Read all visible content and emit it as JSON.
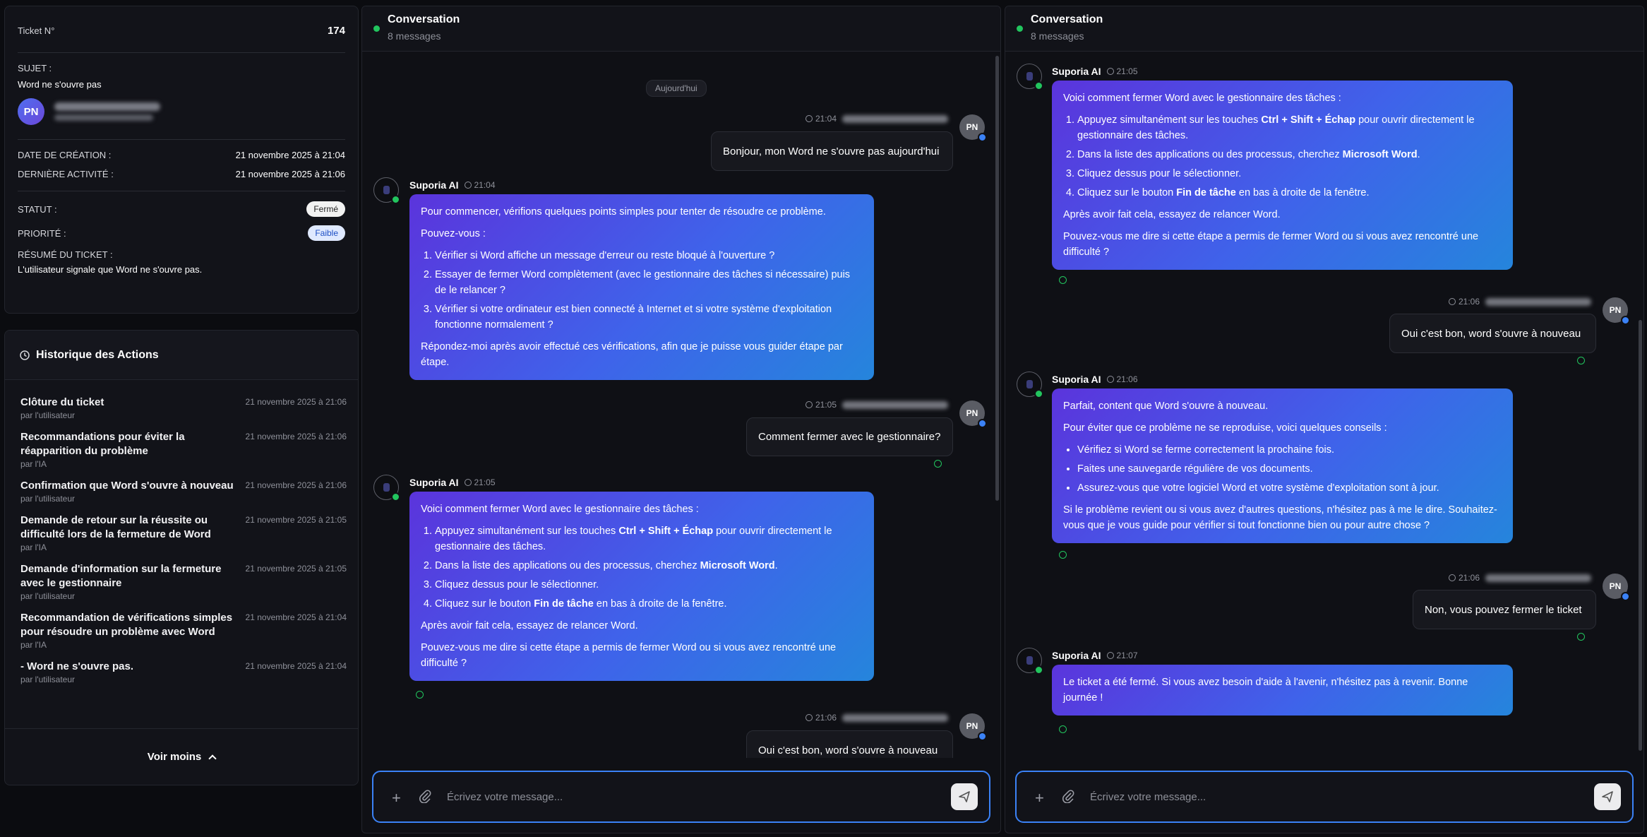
{
  "ticket": {
    "number_label": "Ticket N°",
    "number": "174",
    "subject_label": "SUJET :",
    "subject": "Word ne s'ouvre pas",
    "user_initials": "PN",
    "created_label": "DATE DE CRÉATION :",
    "created": "21 novembre 2025 à 21:04",
    "last_activity_label": "DERNIÈRE ACTIVITÉ :",
    "last_activity": "21 novembre 2025 à 21:06",
    "status_label": "STATUT :",
    "status": "Fermé",
    "priority_label": "PRIORITÉ :",
    "priority": "Faible",
    "summary_label": "RÉSUMÉ DU TICKET :",
    "summary": "L'utilisateur signale que Word ne s'ouvre pas."
  },
  "history": {
    "title": "Historique des Actions",
    "items": [
      {
        "title": "Clôture du ticket",
        "by": "par l'utilisateur",
        "date": "21 novembre 2025 à 21:06"
      },
      {
        "title": "Recommandations pour éviter la réapparition du problème",
        "by": "par l'IA",
        "date": "21 novembre 2025 à 21:06"
      },
      {
        "title": "Confirmation que Word s'ouvre à nouveau",
        "by": "par l'utilisateur",
        "date": "21 novembre 2025 à 21:06"
      },
      {
        "title": "Demande de retour sur la réussite ou difficulté lors de la fermeture de Word",
        "by": "par l'IA",
        "date": "21 novembre 2025 à 21:05"
      },
      {
        "title": "Demande d'information sur la fermeture avec le gestionnaire",
        "by": "par l'utilisateur",
        "date": "21 novembre 2025 à 21:05"
      },
      {
        "title": "Recommandation de vérifications simples pour résoudre un problème avec Word",
        "by": "par l'IA",
        "date": "21 novembre 2025 à 21:04"
      },
      {
        "title": "- Word ne s'ouvre pas.",
        "by": "par l'utilisateur",
        "date": "21 novembre 2025 à 21:04"
      }
    ],
    "toggle": "Voir moins"
  },
  "conversation": {
    "title": "Conversation",
    "count": "8 messages",
    "today": "Aujourd'hui",
    "ai_name": "Suporia AI",
    "user_initials": "PN",
    "placeholder": "Écrivez votre message...",
    "msg1": {
      "time": "21:04",
      "text": "Bonjour, mon Word ne s'ouvre pas aujourd'hui"
    },
    "msg2": {
      "time": "21:04",
      "p1": "Pour commencer, vérifions quelques points simples pour tenter de résoudre ce problème.",
      "p2": "Pouvez-vous :",
      "li1": "Vérifier si Word affiche un message d'erreur ou reste bloqué à l'ouverture ?",
      "li2": "Essayer de fermer Word complètement (avec le gestionnaire des tâches si nécessaire) puis de le relancer ?",
      "li3": "Vérifier si votre ordinateur est bien connecté à Internet et si votre système d'exploitation fonctionne normalement ?",
      "p3": "Répondez-moi après avoir effectué ces vérifications, afin que je puisse vous guider étape par étape."
    },
    "msg3": {
      "time": "21:05",
      "text": "Comment fermer avec le gestionnaire?"
    },
    "msg4": {
      "time": "21:05",
      "p1": "Voici comment fermer Word avec le gestionnaire des tâches :",
      "li1a": "Appuyez simultanément sur les touches ",
      "li1b": "Ctrl + Shift + Échap",
      "li1c": " pour ouvrir directement le gestionnaire des tâches.",
      "li2a": "Dans la liste des applications ou des processus, cherchez ",
      "li2b": "Microsoft Word",
      "li2c": ".",
      "li3": "Cliquez dessus pour le sélectionner.",
      "li4a": "Cliquez sur le bouton ",
      "li4b": "Fin de tâche",
      "li4c": " en bas à droite de la fenêtre.",
      "p2": "Après avoir fait cela, essayez de relancer Word.",
      "p3": "Pouvez-vous me dire si cette étape a permis de fermer Word ou si vous avez rencontré une difficulté ?"
    },
    "msg5": {
      "time": "21:06",
      "text": "Oui c'est bon, word s'ouvre à nouveau"
    },
    "msg6": {
      "time": "21:06",
      "p1": "Parfait, content que Word s'ouvre à nouveau.",
      "p2": "Pour éviter que ce problème ne se reproduise, voici quelques conseils :",
      "li1": "Vérifiez si Word se ferme correctement la prochaine fois.",
      "li2": "Faites une sauvegarde régulière de vos documents.",
      "li3": "Assurez-vous que votre logiciel Word et votre système d'exploitation sont à jour.",
      "p3": "Si le problème revient ou si vous avez d'autres questions, n'hésitez pas à me le dire. Souhaitez-vous que je vous guide pour vérifier si tout fonctionne bien ou pour autre chose ?"
    },
    "msg7": {
      "time": "21:06",
      "text": "Non, vous pouvez fermer le ticket"
    },
    "msg8": {
      "time": "21:07",
      "text": "Le ticket a été fermé. Si vous avez besoin d'aide à l'avenir, n'hésitez pas à revenir. Bonne journée !"
    }
  }
}
